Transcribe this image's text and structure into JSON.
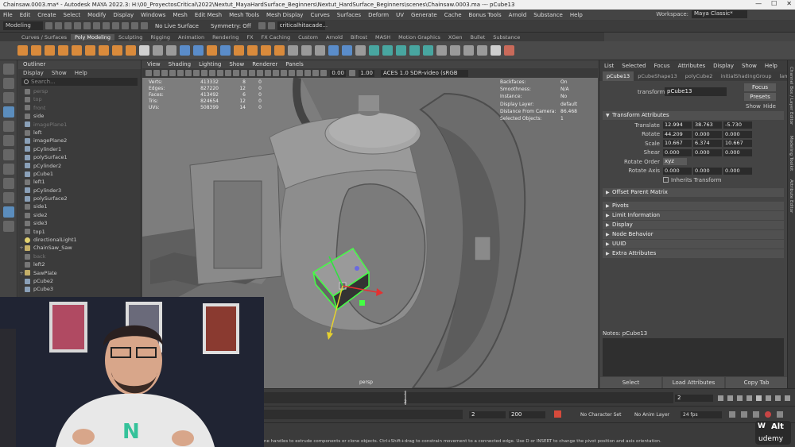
{
  "window": {
    "title": "Chainsaw.0003.ma* - Autodesk MAYA 2022.3: H:\\00_ProyectosCritical\\2022\\Nextut_MayaHardSurface_Beginners\\Nextut_HardSurface_Beginners\\scenes\\Chainsaw.0003.ma --- pCube13"
  },
  "menu": [
    "File",
    "Edit",
    "Create",
    "Select",
    "Modify",
    "Display",
    "Windows",
    "Mesh",
    "Edit Mesh",
    "Mesh Tools",
    "Mesh Display",
    "Curves",
    "Surfaces",
    "Deform",
    "UV",
    "Generate",
    "Cache",
    "Bonus Tools",
    "Arnold",
    "Substance",
    "Help"
  ],
  "workspace": {
    "label": "Workspace:",
    "value": "Maya Classic*"
  },
  "status_line": {
    "mode": "Modeling",
    "live_surface": "No Live Surface",
    "symmetry": "Symmetry: Off",
    "field": "criticalhitacade..."
  },
  "shelf_tabs": [
    "Curves / Surfaces",
    "Poly Modeling",
    "Sculpting",
    "Rigging",
    "Animation",
    "Rendering",
    "FX",
    "FX Caching",
    "Custom",
    "Arnold",
    "Bifrost",
    "MASH",
    "Motion Graphics",
    "XGen",
    "Bullet",
    "Substance"
  ],
  "shelf_active": "Poly Modeling",
  "outliner": {
    "title": "Outliner",
    "menu": [
      "Display",
      "Show",
      "Help"
    ],
    "search_placeholder": "Search...",
    "items": [
      {
        "name": "persp",
        "kind": "cam",
        "dim": true,
        "exp": ""
      },
      {
        "name": "top",
        "kind": "cam",
        "dim": true,
        "exp": ""
      },
      {
        "name": "front",
        "kind": "cam",
        "dim": true,
        "exp": ""
      },
      {
        "name": "side",
        "kind": "cam",
        "dim": false,
        "exp": ""
      },
      {
        "name": "imagePlane1",
        "kind": "mesh",
        "dim": true,
        "exp": ""
      },
      {
        "name": "left",
        "kind": "cam",
        "dim": false,
        "exp": ""
      },
      {
        "name": "imagePlane2",
        "kind": "mesh",
        "dim": false,
        "exp": ""
      },
      {
        "name": "pCylinder1",
        "kind": "mesh",
        "dim": false,
        "exp": ""
      },
      {
        "name": "polySurface1",
        "kind": "mesh",
        "dim": false,
        "exp": ""
      },
      {
        "name": "pCylinder2",
        "kind": "mesh",
        "dim": false,
        "exp": ""
      },
      {
        "name": "pCube1",
        "kind": "mesh",
        "dim": false,
        "exp": ""
      },
      {
        "name": "left1",
        "kind": "cam",
        "dim": false,
        "exp": ""
      },
      {
        "name": "pCylinder3",
        "kind": "mesh",
        "dim": false,
        "exp": ""
      },
      {
        "name": "polySurface2",
        "kind": "mesh",
        "dim": false,
        "exp": ""
      },
      {
        "name": "side1",
        "kind": "cam",
        "dim": false,
        "exp": ""
      },
      {
        "name": "side2",
        "kind": "cam",
        "dim": false,
        "exp": ""
      },
      {
        "name": "side3",
        "kind": "cam",
        "dim": false,
        "exp": ""
      },
      {
        "name": "top1",
        "kind": "cam",
        "dim": false,
        "exp": ""
      },
      {
        "name": "directionalLight1",
        "kind": "light",
        "dim": false,
        "exp": ""
      },
      {
        "name": "ChainSaw_Saw",
        "kind": "grp",
        "dim": false,
        "exp": "+"
      },
      {
        "name": "back",
        "kind": "cam",
        "dim": true,
        "exp": ""
      },
      {
        "name": "left2",
        "kind": "cam",
        "dim": false,
        "exp": ""
      },
      {
        "name": "SawPlate",
        "kind": "grp",
        "dim": false,
        "exp": "+"
      },
      {
        "name": "pCube2",
        "kind": "mesh",
        "dim": false,
        "exp": ""
      },
      {
        "name": "pCube3",
        "kind": "mesh",
        "dim": false,
        "exp": ""
      }
    ]
  },
  "viewport": {
    "menu": [
      "View",
      "Shading",
      "Lighting",
      "Show",
      "Renderer",
      "Panels"
    ],
    "num1": "0.00",
    "num2": "1.00",
    "colorspace": "ACES 1.0 SDR-video (sRGB",
    "hud_left": [
      {
        "label": "Verts:",
        "a": "413332",
        "b": "8",
        "c": "0"
      },
      {
        "label": "Edges:",
        "a": "827220",
        "b": "12",
        "c": "0"
      },
      {
        "label": "Faces:",
        "a": "413492",
        "b": "6",
        "c": "0"
      },
      {
        "label": "Tris:",
        "a": "824654",
        "b": "12",
        "c": "0"
      },
      {
        "label": "UVs:",
        "a": "508399",
        "b": "14",
        "c": "0"
      }
    ],
    "hud_right": [
      {
        "label": "Backfaces:",
        "value": "On"
      },
      {
        "label": "Smoothness:",
        "value": "N/A"
      },
      {
        "label": "Instance:",
        "value": "No"
      },
      {
        "label": "Display Layer:",
        "value": "default"
      },
      {
        "label": "Distance From Camera:",
        "value": "86.468"
      },
      {
        "label": "Selected Objects:",
        "value": "1"
      }
    ],
    "camera_label": "persp"
  },
  "attribute_editor": {
    "menu": [
      "List",
      "Selected",
      "Focus",
      "Attributes",
      "Display",
      "Show",
      "Help"
    ],
    "tabs": [
      "pCube13",
      "pCubeShape13",
      "polyCube2",
      "initialShadingGroup",
      "lamb"
    ],
    "transform_label": "transform:",
    "transform_value": "pCube13",
    "focus_btn": "Focus",
    "presets_btn": "Presets",
    "show_label": "Show",
    "hide_label": "Hide",
    "section_transform": "Transform Attributes",
    "attrs": [
      {
        "label": "Translate",
        "x": "12.994",
        "y": "38.763",
        "z": "-5.730"
      },
      {
        "label": "Rotate",
        "x": "44.209",
        "y": "0.000",
        "z": "0.000"
      },
      {
        "label": "Scale",
        "x": "10.667",
        "y": "6.374",
        "z": "10.667"
      },
      {
        "label": "Shear",
        "x": "0.000",
        "y": "0.000",
        "z": "0.000"
      }
    ],
    "rotate_order_label": "Rotate Order",
    "rotate_order_value": "xyz",
    "rotate_axis_label": "Rotate Axis",
    "rotate_axis": [
      "0.000",
      "0.000",
      "0.000"
    ],
    "inherits_label": "Inherits Transform",
    "offset_parent": "Offset Parent Matrix",
    "sections": [
      "Pivots",
      "Limit Information",
      "Display",
      "Node Behavior",
      "UUID",
      "Extra Attributes"
    ],
    "notes_label": "Notes: pCube13",
    "buttons": [
      "Select",
      "Load Attributes",
      "Copy Tab"
    ]
  },
  "right_strip": [
    "Channel Box / Layer Editor",
    "Modeling Toolkit",
    "Attribute Editor"
  ],
  "timeline": {
    "frame": "2",
    "current_field": "2"
  },
  "range": {
    "start": "2",
    "end": "200",
    "character_set": "No Character Set",
    "anim_layer": "No Anim Layer",
    "fps": "24 fps"
  },
  "help_text": "ne handles to extrude components or clone objects. Ctrl+Shift+drag to constrain movement to a connected edge. Use D or INSERT to change the pivot position and axis orientation.",
  "watermark": {
    "top": "Alt",
    "w": "W",
    "brand": "udemy"
  }
}
